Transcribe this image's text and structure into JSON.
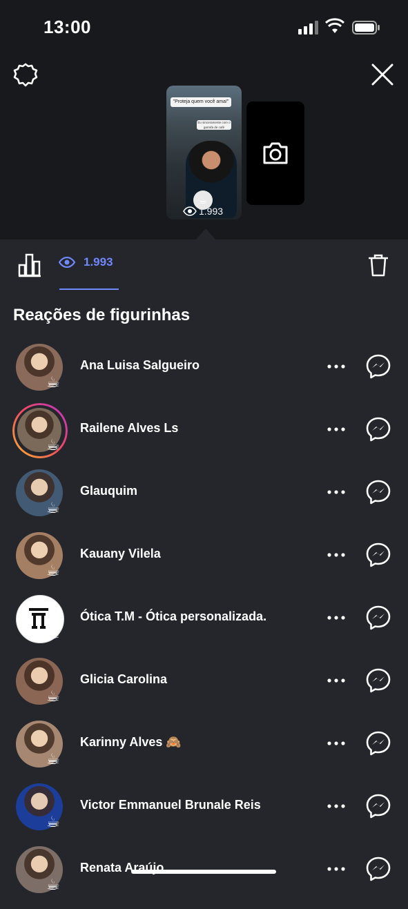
{
  "status_bar": {
    "time": "13:00"
  },
  "story": {
    "quote": "\"Proteja quem você ama!\"",
    "caption": "Eu sinceramente com o garrafa de café",
    "views": "1.993"
  },
  "tabs": {
    "views_count": "1.993"
  },
  "section_title": "Reações de figurinhas",
  "viewers": [
    {
      "name": "Ana Luisa Salgueiro",
      "reaction": "☕",
      "avatar_color": "#8a6b5b",
      "story_ring": false
    },
    {
      "name": "Railene Alves Ls",
      "reaction": "☕",
      "avatar_color": "#7b6a59",
      "story_ring": true
    },
    {
      "name": "Glauquim",
      "reaction": "☕",
      "avatar_color": "#425a73",
      "story_ring": false
    },
    {
      "name": "Kauany Vilela",
      "reaction": "☕",
      "avatar_color": "#a47f63",
      "story_ring": false
    },
    {
      "name": "Ótica T.M - Ótica personalizada.",
      "reaction": "☕",
      "avatar_color": "#ffffff",
      "story_ring": false
    },
    {
      "name": "Glicia Carolina",
      "reaction": "☕",
      "avatar_color": "#8b6655",
      "story_ring": false
    },
    {
      "name": "Karinny Alves 🙈",
      "reaction": "☕",
      "avatar_color": "#a68872",
      "story_ring": false
    },
    {
      "name": "Victor Emmanuel Brunale Reis",
      "reaction": "☕",
      "avatar_color": "#1c3e9a",
      "story_ring": false
    },
    {
      "name": "Renata Araújo",
      "reaction": "☕",
      "avatar_color": "#7d6f68",
      "story_ring": false
    }
  ],
  "colors": {
    "accent": "#6f88ff",
    "background": "#25262b",
    "top_background": "#18191d"
  }
}
